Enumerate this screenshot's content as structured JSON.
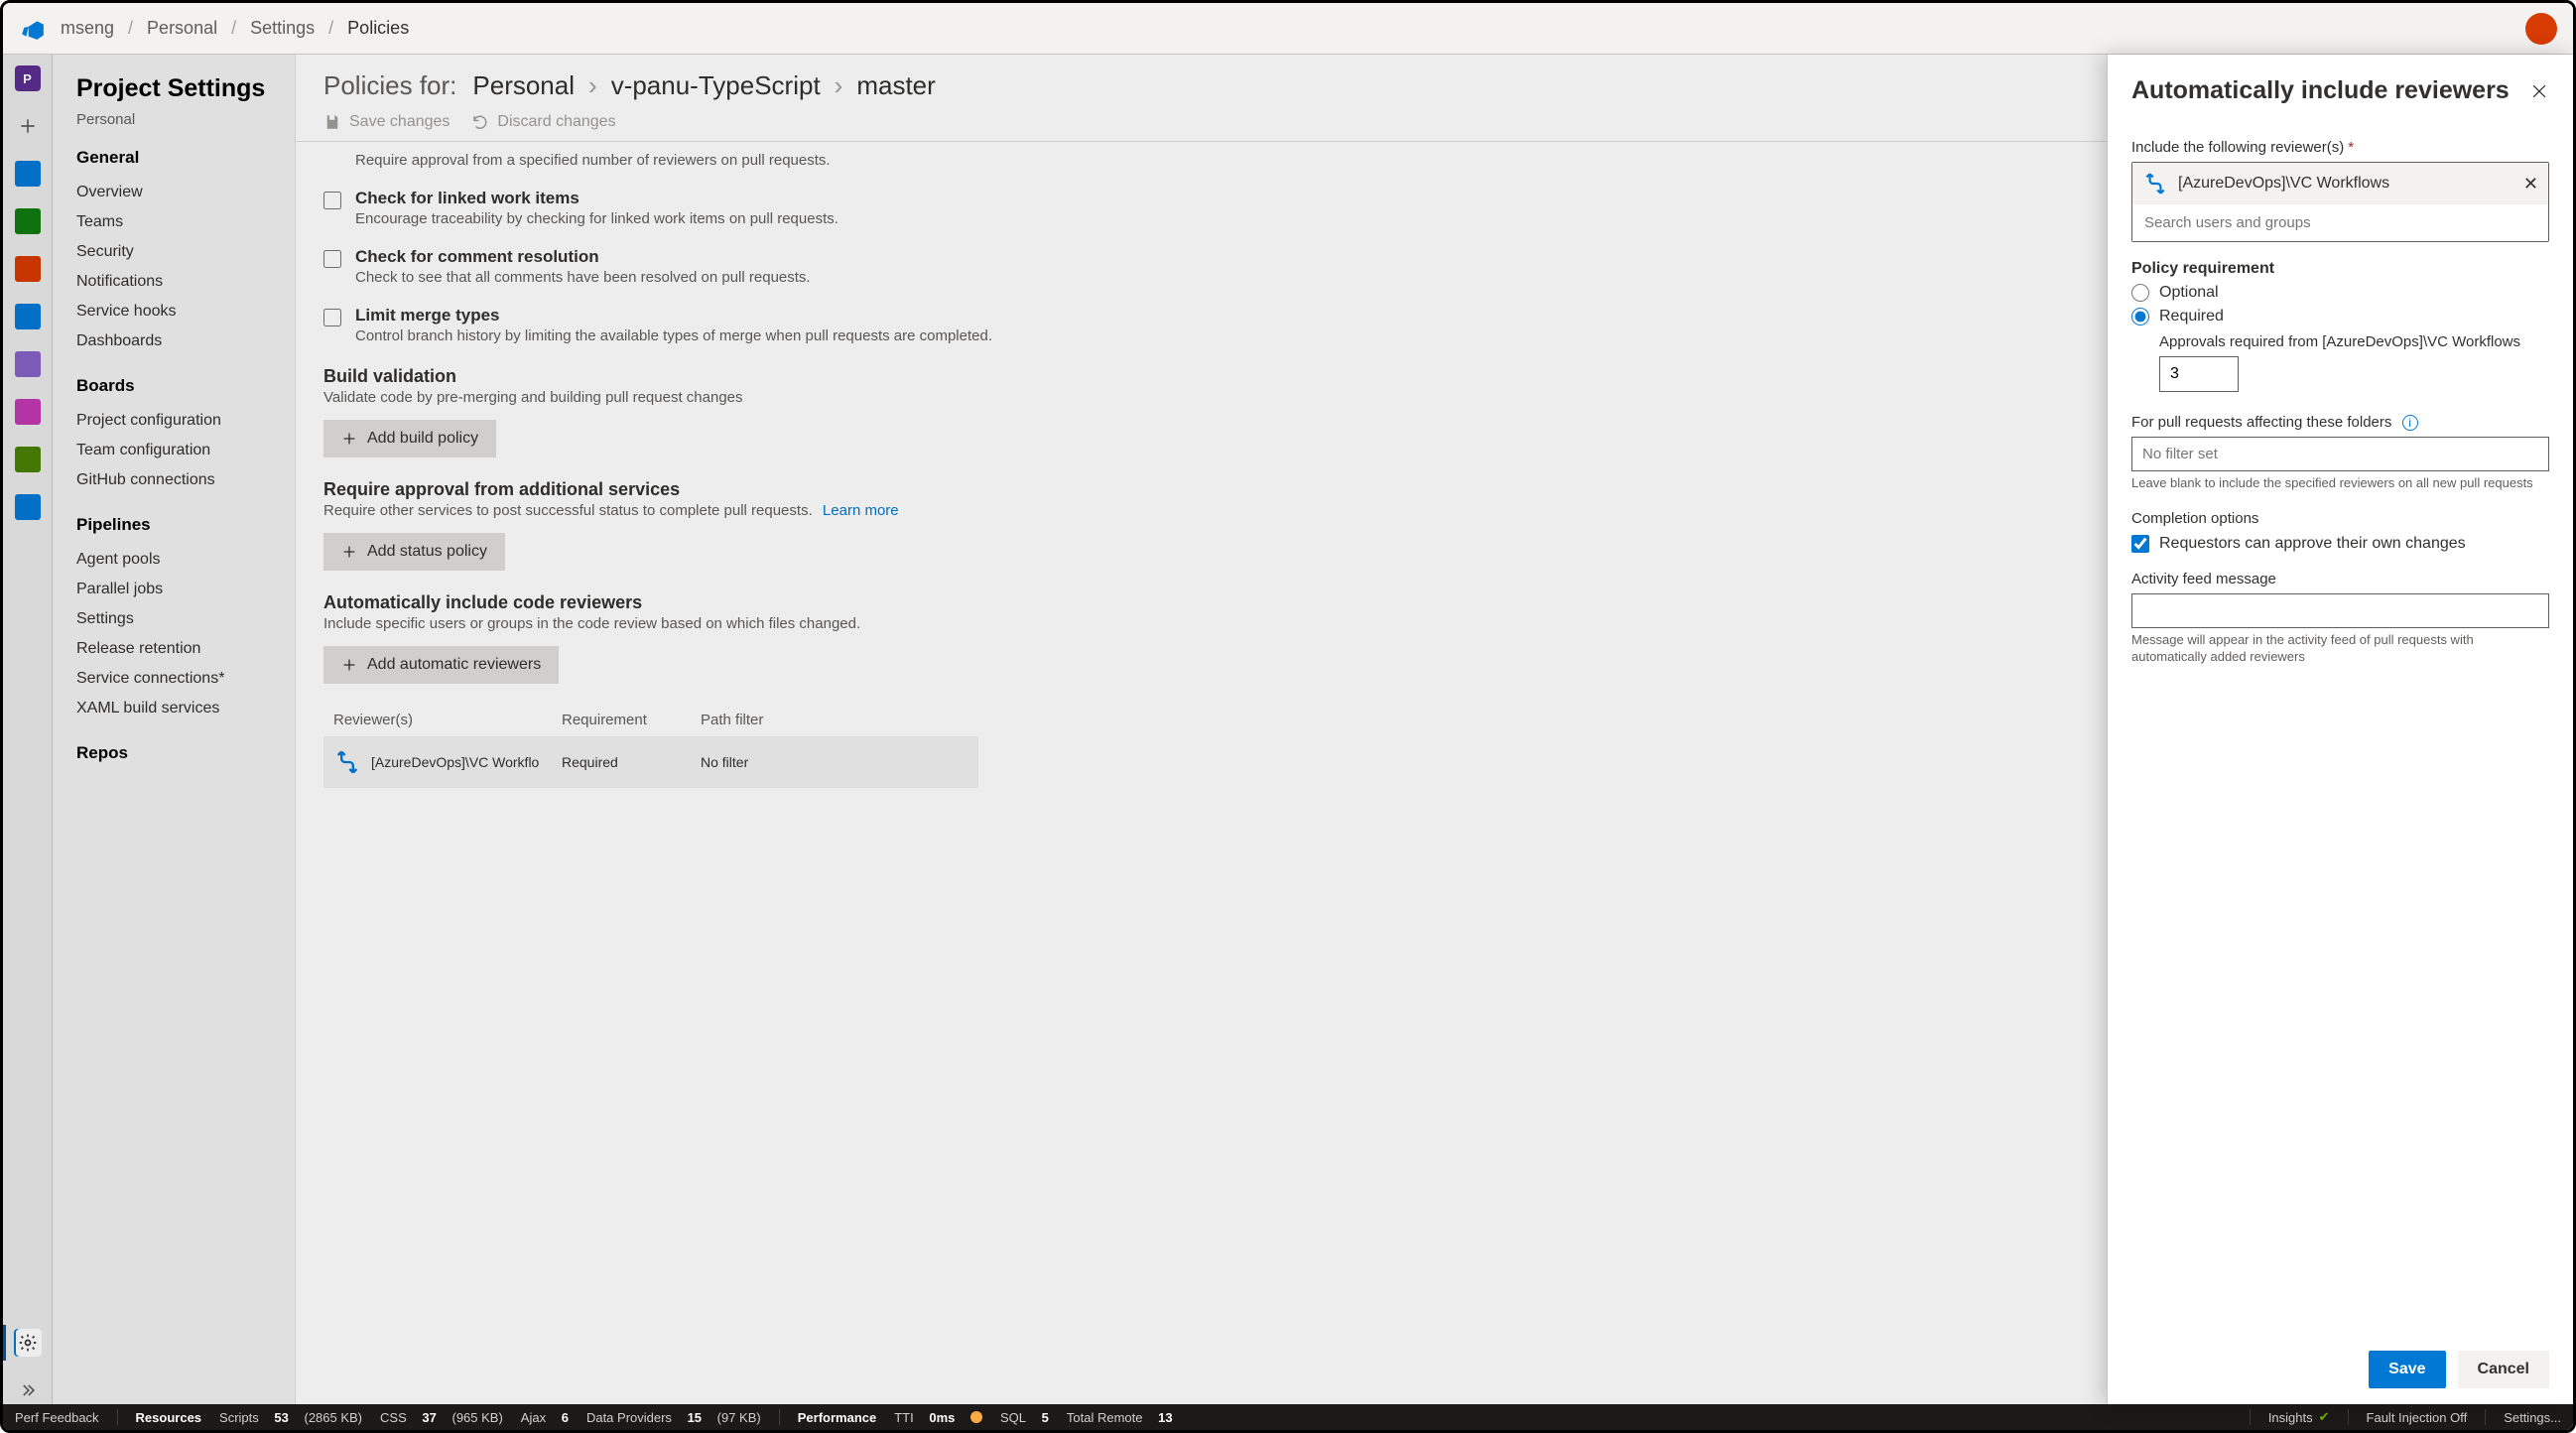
{
  "topbar": {
    "breadcrumb": [
      "mseng",
      "Personal",
      "Settings",
      "Policies"
    ]
  },
  "leftRail": {
    "project_initial": "P"
  },
  "settingsNav": {
    "title": "Project Settings",
    "subtitle": "Personal",
    "groups": [
      {
        "title": "General",
        "items": [
          "Overview",
          "Teams",
          "Security",
          "Notifications",
          "Service hooks",
          "Dashboards"
        ]
      },
      {
        "title": "Boards",
        "items": [
          "Project configuration",
          "Team configuration",
          "GitHub connections"
        ]
      },
      {
        "title": "Pipelines",
        "items": [
          "Agent pools",
          "Parallel jobs",
          "Settings",
          "Release retention",
          "Service connections*",
          "XAML build services"
        ]
      },
      {
        "title": "Repos",
        "items": []
      }
    ]
  },
  "main": {
    "policies_for_label": "Policies for:",
    "crumbs": [
      "Personal",
      "v-panu-TypeScript",
      "master"
    ],
    "save_label": "Save changes",
    "discard_label": "Discard changes",
    "approval_row_desc": "Require approval from a specified number of reviewers on pull requests.",
    "checks": [
      {
        "title": "Check for linked work items",
        "desc": "Encourage traceability by checking for linked work items on pull requests."
      },
      {
        "title": "Check for comment resolution",
        "desc": "Check to see that all comments have been resolved on pull requests."
      },
      {
        "title": "Limit merge types",
        "desc": "Control branch history by limiting the available types of merge when pull requests are completed."
      }
    ],
    "build_validation": {
      "title": "Build validation",
      "desc": "Validate code by pre-merging and building pull request changes",
      "button": "Add build policy"
    },
    "status_policy": {
      "title": "Require approval from additional services",
      "desc": "Require other services to post successful status to complete pull requests.",
      "learn": "Learn more",
      "button": "Add status policy"
    },
    "auto_reviewers": {
      "title": "Automatically include code reviewers",
      "desc": "Include specific users or groups in the code review based on which files changed.",
      "button": "Add automatic reviewers"
    },
    "table": {
      "headers": [
        "Reviewer(s)",
        "Requirement",
        "Path filter"
      ],
      "row": {
        "reviewer": "[AzureDevOps]\\VC Workflo",
        "requirement": "Required",
        "path": "No filter"
      }
    }
  },
  "panel": {
    "title": "Automatically include reviewers",
    "include_label": "Include the following reviewer(s)",
    "token_name": "[AzureDevOps]\\VC Workflows",
    "search_placeholder": "Search users and groups",
    "policy_req_label": "Policy requirement",
    "optional_label": "Optional",
    "required_label": "Required",
    "approvals_label": "Approvals required from [AzureDevOps]\\VC Workflows",
    "approvals_value": "3",
    "folders_label": "For pull requests affecting these folders",
    "filter_placeholder": "No filter set",
    "filter_hint": "Leave blank to include the specified reviewers on all new pull requests",
    "completion_label": "Completion options",
    "self_approve_label": "Requestors can approve their own changes",
    "activity_label": "Activity feed message",
    "activity_hint": "Message will appear in the activity feed of pull requests with automatically added reviewers",
    "save": "Save",
    "cancel": "Cancel"
  },
  "statusbar": {
    "perf_feedback": "Perf Feedback",
    "resources": "Resources",
    "scripts_label": "Scripts",
    "scripts_count": "53",
    "scripts_size": "(2865 KB)",
    "css_label": "CSS",
    "css_count": "37",
    "css_size": "(965 KB)",
    "ajax_label": "Ajax",
    "ajax_count": "6",
    "dp_label": "Data Providers",
    "dp_count": "15",
    "dp_size": "(97 KB)",
    "performance": "Performance",
    "tti_label": "TTI",
    "tti_value": "0ms",
    "sql_label": "SQL",
    "sql_count": "5",
    "total_remote_label": "Total Remote",
    "total_remote_count": "13",
    "insights": "Insights",
    "fault": "Fault Injection Off",
    "settings": "Settings..."
  }
}
